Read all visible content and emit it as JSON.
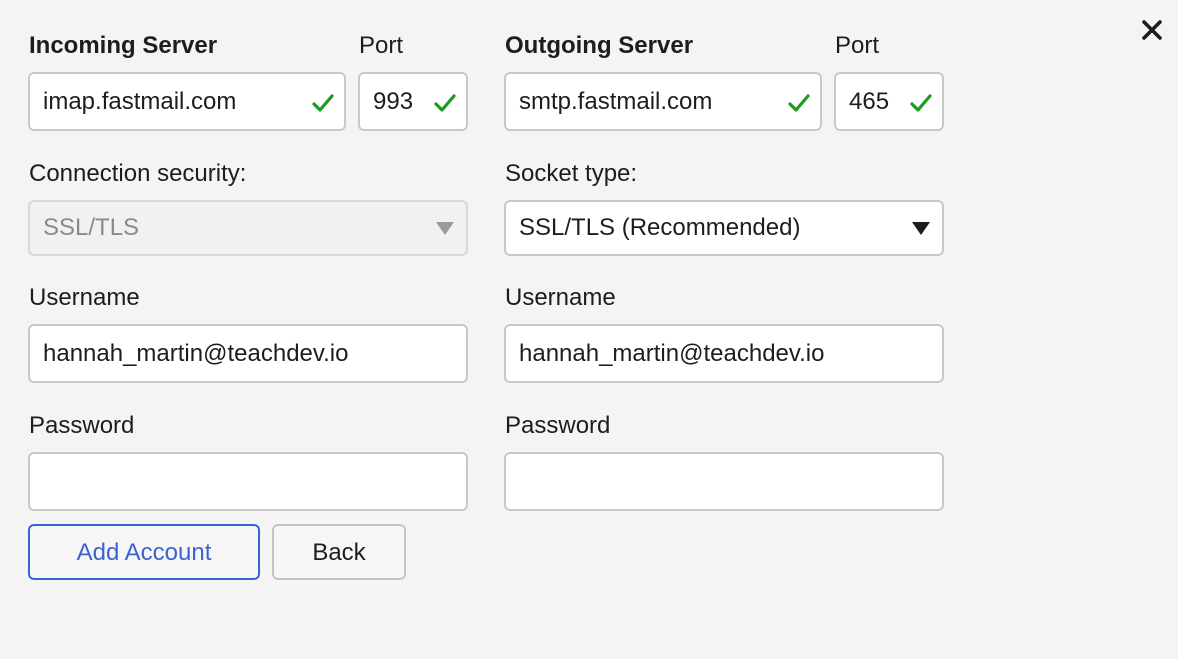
{
  "close_icon": "close-icon",
  "incoming": {
    "server_label": "Incoming Server",
    "port_label": "Port",
    "server_value": "imap.fastmail.com",
    "port_value": "993",
    "security_label": "Connection security:",
    "security_value": "SSL/TLS",
    "username_label": "Username",
    "username_value": "hannah_martin@teachdev.io",
    "password_label": "Password",
    "password_value": ""
  },
  "outgoing": {
    "server_label": "Outgoing Server",
    "port_label": "Port",
    "server_value": "smtp.fastmail.com",
    "port_value": "465",
    "socket_label": "Socket type:",
    "socket_value": "SSL/TLS (Recommended)",
    "username_label": "Username",
    "username_value": "hannah_martin@teachdev.io",
    "password_label": "Password",
    "password_value": ""
  },
  "buttons": {
    "add_account": "Add Account",
    "back": "Back"
  },
  "colors": {
    "accent": "#3b63d6",
    "valid": "#1e9a1e"
  }
}
